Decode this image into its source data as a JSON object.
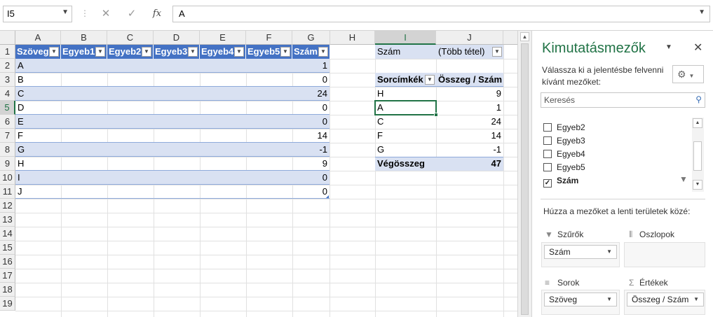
{
  "formula_bar": {
    "name_box": "I5",
    "cancel_icon": "✕",
    "enter_icon": "✓",
    "fx_label": "fx",
    "formula_value": "A"
  },
  "columns": [
    "A",
    "B",
    "C",
    "D",
    "E",
    "F",
    "G",
    "H",
    "I",
    "J"
  ],
  "rows": [
    "1",
    "2",
    "3",
    "4",
    "5",
    "6",
    "7",
    "8",
    "9",
    "10",
    "11",
    "12",
    "13",
    "14",
    "15",
    "16",
    "17",
    "18",
    "19"
  ],
  "table": {
    "headers": [
      "Szöveg",
      "Egyeb1",
      "Egyeb2",
      "Egyeb3",
      "Egyeb4",
      "Egyeb5",
      "Szám"
    ],
    "rows": [
      {
        "text": "A",
        "num": "1"
      },
      {
        "text": "B",
        "num": "0"
      },
      {
        "text": "C",
        "num": "24"
      },
      {
        "text": "D",
        "num": "0"
      },
      {
        "text": "E",
        "num": "0"
      },
      {
        "text": "F",
        "num": "14"
      },
      {
        "text": "G",
        "num": "-1"
      },
      {
        "text": "H",
        "num": "9"
      },
      {
        "text": "I",
        "num": "0"
      },
      {
        "text": "J",
        "num": "0"
      }
    ]
  },
  "pivot": {
    "filter_label": "Szám",
    "filter_value": "(Több tétel)",
    "row_labels_header": "Sorcímkék",
    "values_header": "Összeg / Szám",
    "rows": [
      {
        "label": "H",
        "value": "9"
      },
      {
        "label": "A",
        "value": "1"
      },
      {
        "label": "C",
        "value": "24"
      },
      {
        "label": "F",
        "value": "14"
      },
      {
        "label": "G",
        "value": "-1"
      }
    ],
    "total_label": "Végösszeg",
    "total_value": "47"
  },
  "pane": {
    "title": "Kimutatásmezők",
    "subtitle": "Válassza ki a jelentésbe felvenni kívánt mezőket:",
    "search_placeholder": "Keresés",
    "fields": [
      {
        "label": "Egyeb2",
        "checked": false
      },
      {
        "label": "Egyeb3",
        "checked": false
      },
      {
        "label": "Egyeb4",
        "checked": false
      },
      {
        "label": "Egyeb5",
        "checked": false
      },
      {
        "label": "Szám",
        "checked": true
      }
    ],
    "drag_hint": "Húzza a mezőket a lenti területek közé:",
    "areas": {
      "filters": {
        "title": "Szűrők",
        "item": "Szám"
      },
      "columns": {
        "title": "Oszlopok",
        "item": ""
      },
      "rows": {
        "title": "Sorok",
        "item": "Szöveg"
      },
      "values": {
        "title": "Értékek",
        "item": "Összeg / Szám"
      }
    }
  },
  "colors": {
    "accent": "#217346",
    "table_header": "#4472c4",
    "band": "#d9e1f2"
  }
}
